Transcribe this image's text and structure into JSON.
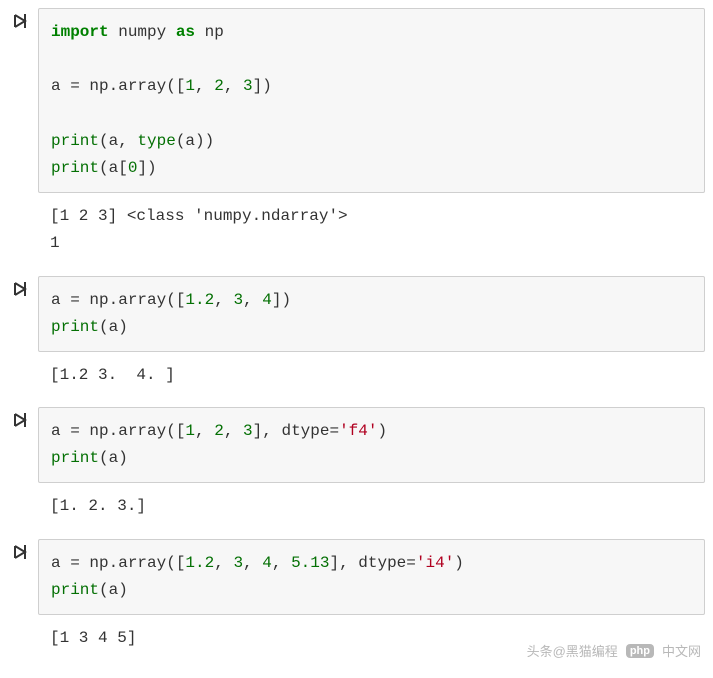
{
  "cells": [
    {
      "code_html": "<span class='kw'>import</span> numpy <span class='kw'>as</span> np\n\na = np.array([<span class='num'>1</span>, <span class='num'>2</span>, <span class='num'>3</span>])\n\n<span class='fn'>print</span>(a, <span class='fn'>type</span>(a))\n<span class='fn'>print</span>(a[<span class='num'>0</span>])",
      "output": "[1 2 3] <class 'numpy.ndarray'>\n1"
    },
    {
      "code_html": "a = np.array([<span class='num'>1.2</span>, <span class='num'>3</span>, <span class='num'>4</span>])\n<span class='fn'>print</span>(a)",
      "output": "[1.2 3.  4. ]"
    },
    {
      "code_html": "a = np.array([<span class='num'>1</span>, <span class='num'>2</span>, <span class='num'>3</span>], dtype=<span class='str'>'f4'</span>)\n<span class='fn'>print</span>(a)",
      "output": "[1. 2. 3.]"
    },
    {
      "code_html": "a = np.array([<span class='num'>1.2</span>, <span class='num'>3</span>, <span class='num'>4</span>, <span class='num'>5.13</span>], dtype=<span class='str'>'i4'</span>)\n<span class='fn'>print</span>(a)",
      "output": "[1 3 4 5]"
    }
  ],
  "watermark": {
    "left_text": "头条@黑猫编程",
    "logo_text": "php",
    "right_text": "中文网"
  }
}
